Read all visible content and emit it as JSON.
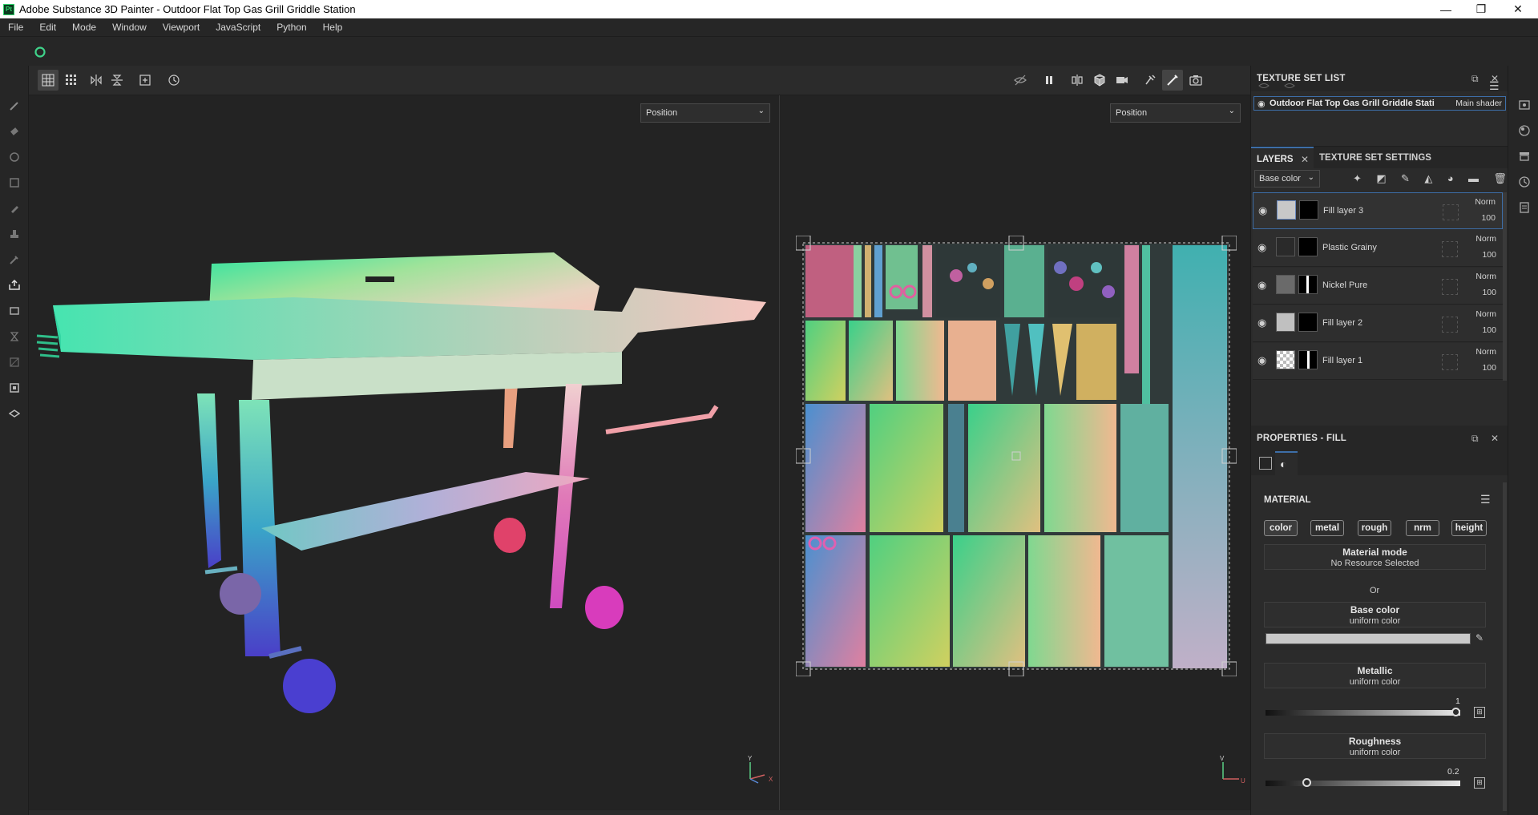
{
  "window": {
    "title": "Adobe Substance 3D Painter - Outdoor Flat Top Gas Grill Griddle Station",
    "app_icon_text": "Pt",
    "controls": [
      "—",
      "❐",
      "✕"
    ]
  },
  "menu": [
    "File",
    "Edit",
    "Mode",
    "Window",
    "Viewport",
    "JavaScript",
    "Python",
    "Help"
  ],
  "viewports": {
    "left_dropdown": "Position",
    "right_dropdown": "Position",
    "axis_3d": {
      "y": "Y",
      "x": "X"
    },
    "axis_2d": {
      "v": "V",
      "u": "U"
    }
  },
  "texture_set_list": {
    "title": "TEXTURE SET LIST",
    "item_name": "Outdoor Flat Top Gas Grill Griddle Stati",
    "item_shader": "Main shader"
  },
  "layers_panel": {
    "tab_layers": "LAYERS",
    "tab_settings": "TEXTURE SET SETTINGS",
    "channel": "Base color",
    "layers": [
      {
        "name": "Fill layer 3",
        "blend": "Norm",
        "opacity": "100"
      },
      {
        "name": "Plastic Grainy",
        "blend": "Norm",
        "opacity": "100"
      },
      {
        "name": "Nickel Pure",
        "blend": "Norm",
        "opacity": "100"
      },
      {
        "name": "Fill layer 2",
        "blend": "Norm",
        "opacity": "100"
      },
      {
        "name": "Fill layer 1",
        "blend": "Norm",
        "opacity": "100"
      }
    ]
  },
  "properties": {
    "title": "PROPERTIES - FILL",
    "section": "MATERIAL",
    "channels": [
      "color",
      "metal",
      "rough",
      "nrm",
      "height"
    ],
    "material_mode": {
      "label": "Material mode",
      "value": "No Resource Selected"
    },
    "or": "Or",
    "base_color": {
      "label": "Base color",
      "value": "uniform color",
      "swatch": "#c8c8c8"
    },
    "metallic": {
      "label": "Metallic",
      "value": "uniform color",
      "amount": "1",
      "fraction": 1.0
    },
    "roughness": {
      "label": "Roughness",
      "value": "uniform color",
      "amount": "0.2",
      "fraction": 0.2
    }
  },
  "colors": {
    "accent": "#3d6ea8",
    "panel": "#2b2b2b",
    "bg": "#1b1b1b"
  }
}
